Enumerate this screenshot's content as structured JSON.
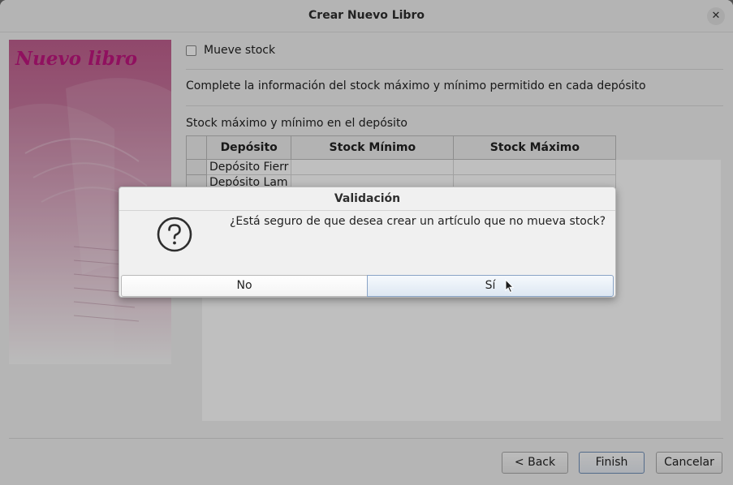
{
  "window": {
    "title": "Crear Nuevo Libro",
    "close_glyph": "✕"
  },
  "side_image": {
    "brand_text": "Nuevo libro"
  },
  "form": {
    "checkbox_label": "Mueve stock",
    "checkbox_checked": false,
    "info_text": "Complete la información del stock máximo y mínimo permitido en cada depósito",
    "table_caption": "Stock máximo y mínimo en el depósito",
    "table": {
      "columns": [
        "Depósito",
        "Stock Mínimo",
        "Stock Máximo"
      ],
      "rows": [
        [
          "Depósito Fierr",
          "",
          ""
        ],
        [
          "Depósito Lam",
          "",
          ""
        ]
      ]
    }
  },
  "footer": {
    "back_label": "< Back",
    "finish_label": "Finish",
    "cancel_label": "Cancelar"
  },
  "dialog": {
    "title": "Validación",
    "message": "¿Está seguro de que desea crear un artículo que no mueva stock?",
    "icon": "question-icon",
    "no_label": "No",
    "yes_label": "Sí"
  }
}
